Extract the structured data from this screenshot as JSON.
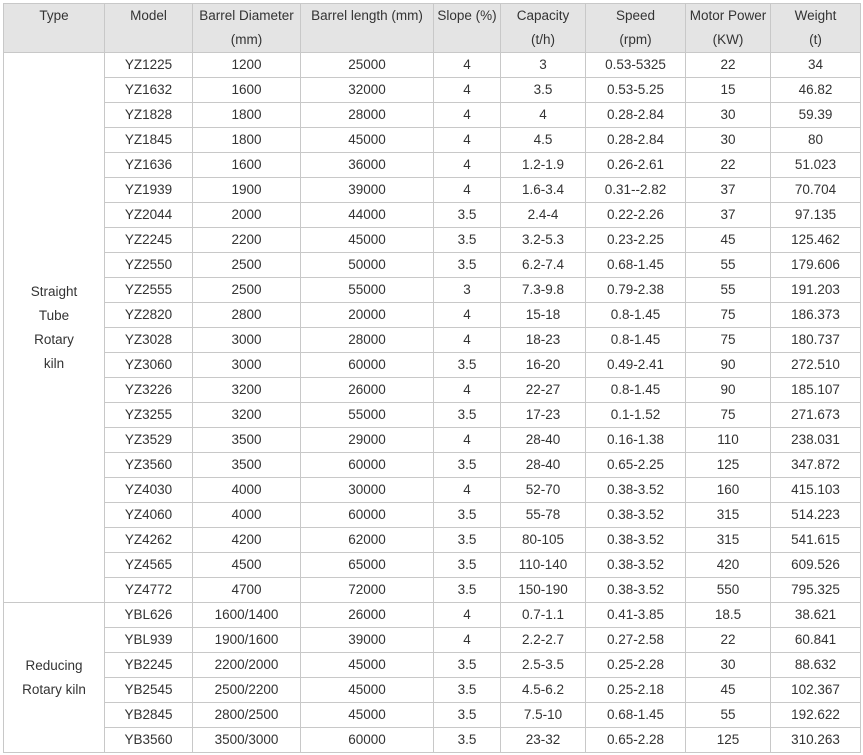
{
  "headers": [
    {
      "line1": "Type",
      "line2": ""
    },
    {
      "line1": "Model",
      "line2": ""
    },
    {
      "line1": "Barrel Diameter",
      "line2": "(mm)"
    },
    {
      "line1": "Barrel length (mm)",
      "line2": ""
    },
    {
      "line1": "Slope (%)",
      "line2": ""
    },
    {
      "line1": "Capacity",
      "line2": "(t/h)"
    },
    {
      "line1": "Speed",
      "line2": "(rpm)"
    },
    {
      "line1": "Motor Power",
      "line2": "(KW)"
    },
    {
      "line1": "Weight",
      "line2": "(t)"
    }
  ],
  "groups": [
    {
      "type_lines": [
        "Straight",
        "Tube",
        "Rotary",
        "kiln"
      ],
      "rows": [
        [
          "YZ1225",
          "1200",
          "25000",
          "4",
          "3",
          "0.53-5325",
          "22",
          "34"
        ],
        [
          "YZ1632",
          "1600",
          "32000",
          "4",
          "3.5",
          "0.53-5.25",
          "15",
          "46.82"
        ],
        [
          "YZ1828",
          "1800",
          "28000",
          "4",
          "4",
          "0.28-2.84",
          "30",
          "59.39"
        ],
        [
          "YZ1845",
          "1800",
          "45000",
          "4",
          "4.5",
          "0.28-2.84",
          "30",
          "80"
        ],
        [
          "YZ1636",
          "1600",
          "36000",
          "4",
          "1.2-1.9",
          "0.26-2.61",
          "22",
          "51.023"
        ],
        [
          "YZ1939",
          "1900",
          "39000",
          "4",
          "1.6-3.4",
          "0.31--2.82",
          "37",
          "70.704"
        ],
        [
          "YZ2044",
          "2000",
          "44000",
          "3.5",
          "2.4-4",
          "0.22-2.26",
          "37",
          "97.135"
        ],
        [
          "YZ2245",
          "2200",
          "45000",
          "3.5",
          "3.2-5.3",
          "0.23-2.25",
          "45",
          "125.462"
        ],
        [
          "YZ2550",
          "2500",
          "50000",
          "3.5",
          "6.2-7.4",
          "0.68-1.45",
          "55",
          "179.606"
        ],
        [
          "YZ2555",
          "2500",
          "55000",
          "3",
          "7.3-9.8",
          "0.79-2.38",
          "55",
          "191.203"
        ],
        [
          "YZ2820",
          "2800",
          "20000",
          "4",
          "15-18",
          "0.8-1.45",
          "75",
          "186.373"
        ],
        [
          "YZ3028",
          "3000",
          "28000",
          "4",
          "18-23",
          "0.8-1.45",
          "75",
          "180.737"
        ],
        [
          "YZ3060",
          "3000",
          "60000",
          "3.5",
          "16-20",
          "0.49-2.41",
          "90",
          "272.510"
        ],
        [
          "YZ3226",
          "3200",
          "26000",
          "4",
          "22-27",
          "0.8-1.45",
          "90",
          "185.107"
        ],
        [
          "YZ3255",
          "3200",
          "55000",
          "3.5",
          "17-23",
          "0.1-1.52",
          "75",
          "271.673"
        ],
        [
          "YZ3529",
          "3500",
          "29000",
          "4",
          "28-40",
          "0.16-1.38",
          "110",
          "238.031"
        ],
        [
          "YZ3560",
          "3500",
          "60000",
          "3.5",
          "28-40",
          "0.65-2.25",
          "125",
          "347.872"
        ],
        [
          "YZ4030",
          "4000",
          "30000",
          "4",
          "52-70",
          "0.38-3.52",
          "160",
          "415.103"
        ],
        [
          "YZ4060",
          "4000",
          "60000",
          "3.5",
          "55-78",
          "0.38-3.52",
          "315",
          "514.223"
        ],
        [
          "YZ4262",
          "4200",
          "62000",
          "3.5",
          "80-105",
          "0.38-3.52",
          "315",
          "541.615"
        ],
        [
          "YZ4565",
          "4500",
          "65000",
          "3.5",
          "110-140",
          "0.38-3.52",
          "420",
          "609.526"
        ],
        [
          "YZ4772",
          "4700",
          "72000",
          "3.5",
          "150-190",
          "0.38-3.52",
          "550",
          "795.325"
        ]
      ]
    },
    {
      "type_lines": [
        "Reducing",
        "Rotary kiln"
      ],
      "rows": [
        [
          "YBL626",
          "1600/1400",
          "26000",
          "4",
          "0.7-1.1",
          "0.41-3.85",
          "18.5",
          "38.621"
        ],
        [
          "YBL939",
          "1900/1600",
          "39000",
          "4",
          "2.2-2.7",
          "0.27-2.58",
          "22",
          "60.841"
        ],
        [
          "YB2245",
          "2200/2000",
          "45000",
          "3.5",
          "2.5-3.5",
          "0.25-2.28",
          "30",
          "88.632"
        ],
        [
          "YB2545",
          "2500/2200",
          "45000",
          "3.5",
          "4.5-6.2",
          "0.25-2.18",
          "45",
          "102.367"
        ],
        [
          "YB2845",
          "2800/2500",
          "45000",
          "3.5",
          "7.5-10",
          "0.68-1.45",
          "55",
          "192.622"
        ],
        [
          "YB3560",
          "3500/3000",
          "60000",
          "3.5",
          "23-32",
          "0.65-2.28",
          "125",
          "310.263"
        ]
      ]
    }
  ]
}
